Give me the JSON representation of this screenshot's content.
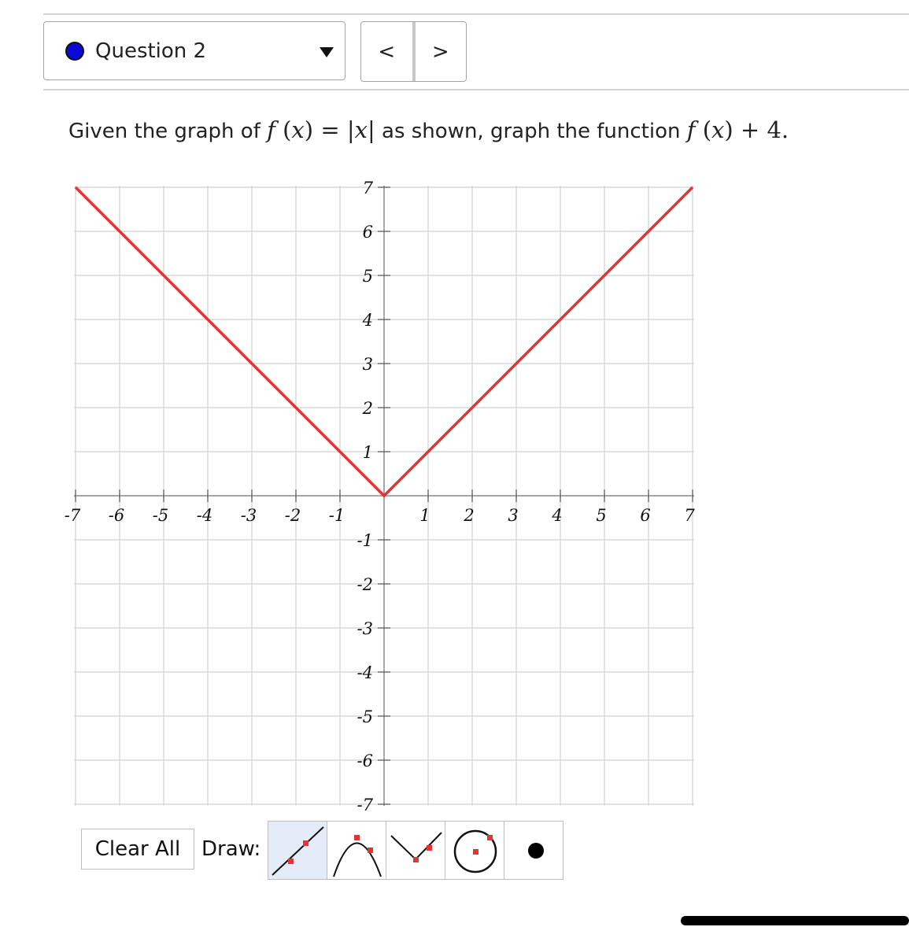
{
  "header": {
    "question_label": "Question 2",
    "status_color": "#0a0ad6",
    "prev_label": "<",
    "next_label": ">"
  },
  "prompt": {
    "lead": "Given the graph of ",
    "given_function": "f (x) = |x|",
    "middle": " as shown, graph the function ",
    "target_function": "f (x) + 4."
  },
  "graph": {
    "x_ticks": [
      "-7",
      "-6",
      "-5",
      "-4",
      "-3",
      "-2",
      "-1",
      "1",
      "2",
      "3",
      "4",
      "5",
      "6",
      "7"
    ],
    "y_ticks": [
      "7",
      "6",
      "5",
      "4",
      "3",
      "2",
      "1",
      "-1",
      "-2",
      "-3",
      "-4",
      "-5",
      "-6",
      "-7"
    ],
    "x_range": [
      -7,
      7
    ],
    "y_range": [
      -7,
      7
    ],
    "grid": true,
    "curve_color": "#e53232",
    "curve_points": [
      [
        -7,
        7
      ],
      [
        0,
        0
      ],
      [
        7,
        7
      ]
    ]
  },
  "toolbar": {
    "clear_all_label": "Clear All",
    "draw_label": "Draw:",
    "tools": [
      {
        "name": "line-tool",
        "icon": "line-icon",
        "active": true
      },
      {
        "name": "parabola-tool",
        "icon": "parabola-icon",
        "active": false
      },
      {
        "name": "absolute-value-tool",
        "icon": "absolute-value-icon",
        "active": false
      },
      {
        "name": "circle-tool",
        "icon": "circle-icon",
        "active": false
      },
      {
        "name": "point-tool",
        "icon": "point-icon",
        "active": false
      }
    ]
  }
}
